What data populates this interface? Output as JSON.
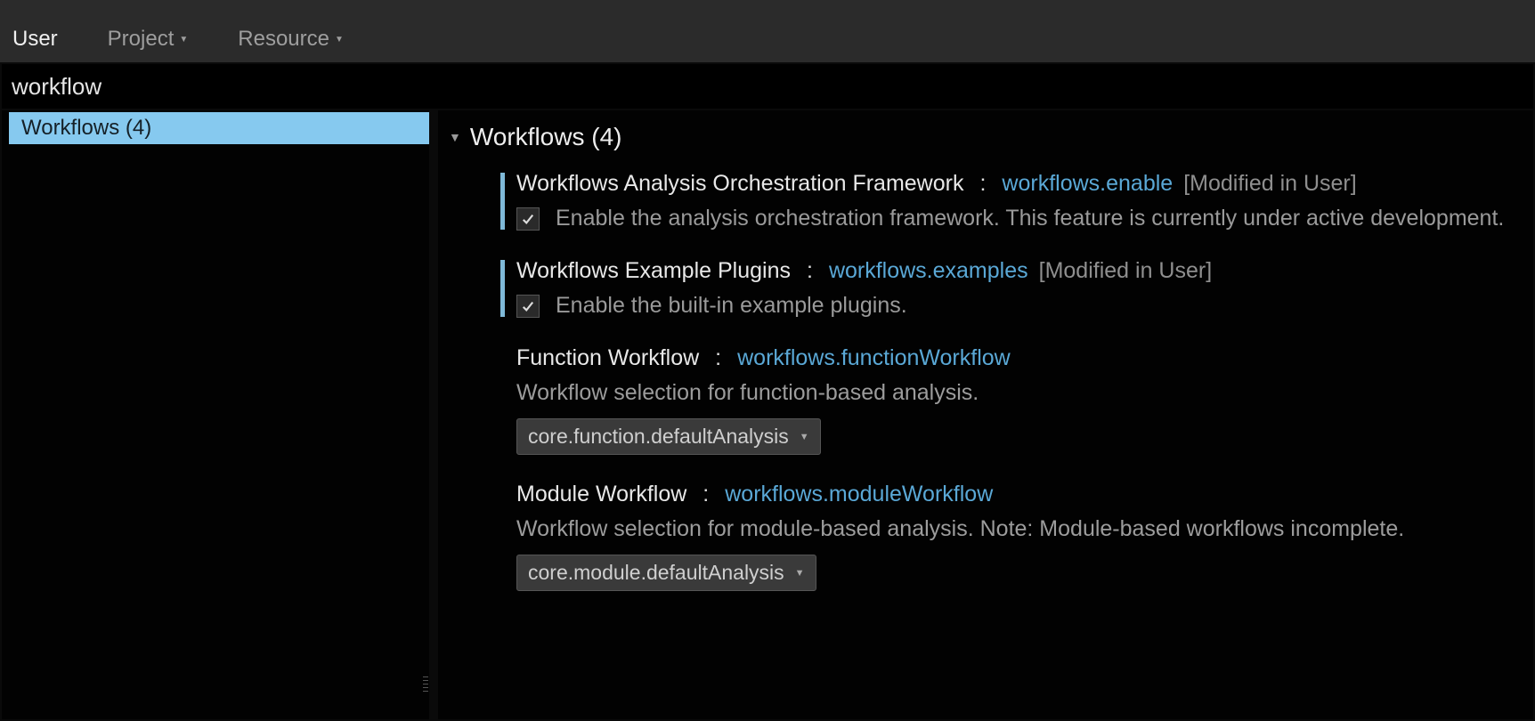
{
  "tabs": {
    "user": "User",
    "project": "Project",
    "resource": "Resource"
  },
  "search": {
    "value": "workflow"
  },
  "sidebar": {
    "items": [
      {
        "label": "Workflows (4)"
      }
    ]
  },
  "section": {
    "title": "Workflows (4)",
    "modified_badge": "[Modified in User]",
    "settings": [
      {
        "title": "Workflows Analysis Orchestration Framework",
        "key": "workflows.enable",
        "modified": true,
        "type": "checkbox",
        "checked": true,
        "description": "Enable the analysis orchestration framework. This feature is currently under active development."
      },
      {
        "title": "Workflows Example Plugins",
        "key": "workflows.examples",
        "modified": true,
        "type": "checkbox",
        "checked": true,
        "description": "Enable the built-in example plugins."
      },
      {
        "title": "Function Workflow",
        "key": "workflows.functionWorkflow",
        "modified": false,
        "type": "dropdown",
        "value": "core.function.defaultAnalysis",
        "description": "Workflow selection for function-based analysis."
      },
      {
        "title": "Module Workflow",
        "key": "workflows.moduleWorkflow",
        "modified": false,
        "type": "dropdown",
        "value": "core.module.defaultAnalysis",
        "description": "Workflow selection for module-based analysis. Note: Module-based workflows incomplete."
      }
    ]
  }
}
